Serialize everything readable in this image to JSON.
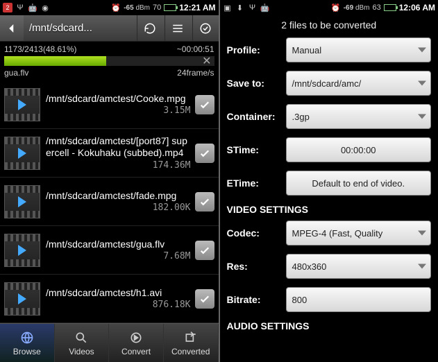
{
  "left": {
    "status": {
      "badge": "2",
      "signal": "-65",
      "unit": "dBm",
      "battery": "70",
      "time": "12:21 AM"
    },
    "topbar": {
      "path": "/mnt/sdcard..."
    },
    "progress": {
      "counter": "1173/2413(48.61%)",
      "remaining": "~00:00:51",
      "filename": "gua.flv",
      "rate": "24frame/s",
      "percent": 48.61
    },
    "files": [
      {
        "name": "/mnt/sdcard/amctest/Cooke.mpg",
        "size": "3.15M"
      },
      {
        "name": "/mnt/sdcard/amctest/[port87] supercell - Kokuhaku (subbed).mp4",
        "size": "174.36M"
      },
      {
        "name": "/mnt/sdcard/amctest/fade.mpg",
        "size": "182.00K"
      },
      {
        "name": "/mnt/sdcard/amctest/gua.flv",
        "size": "7.68M"
      },
      {
        "name": "/mnt/sdcard/amctest/h1.avi",
        "size": "876.18K"
      }
    ],
    "tabs": [
      {
        "label": "Browse"
      },
      {
        "label": "Videos"
      },
      {
        "label": "Convert"
      },
      {
        "label": "Converted"
      }
    ]
  },
  "right": {
    "status": {
      "signal": "-69",
      "unit": "dBm",
      "battery": "63",
      "time": "12:06 AM"
    },
    "header": "2  files to be converted",
    "fields": {
      "profile_label": "Profile:",
      "profile_value": "Manual",
      "saveto_label": "Save to:",
      "saveto_value": "/mnt/sdcard/amc/",
      "container_label": "Container:",
      "container_value": ".3gp",
      "stime_label": "STime:",
      "stime_value": "00:00:00",
      "etime_label": "ETime:",
      "etime_value": "Default to end of video.",
      "video_section": "VIDEO SETTINGS",
      "codec_label": "Codec:",
      "codec_value": "MPEG-4 (Fast, Quality",
      "res_label": "Res:",
      "res_value": "480x360",
      "bitrate_label": "Bitrate:",
      "bitrate_value": "800",
      "audio_section": "AUDIO SETTINGS"
    }
  }
}
